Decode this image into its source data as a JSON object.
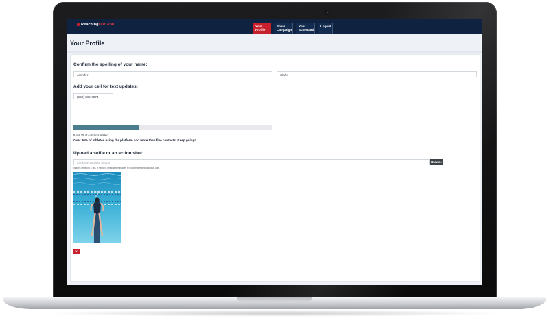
{
  "header": {
    "logo_main": "Reaching",
    "logo_accent": "OurGoal",
    "nav": [
      {
        "label": "Your Profile",
        "active": true
      },
      {
        "label": "Share Campaign",
        "active": false
      },
      {
        "label": "Your Scorecard",
        "active": false
      },
      {
        "label": "Logout",
        "active": false
      }
    ]
  },
  "page": {
    "title": "Your Profile",
    "name_section": {
      "label": "Confirm the spelling of your name:",
      "first_name": "Jennifer",
      "last_name": "Clark"
    },
    "cell_section": {
      "label": "Add your cell for text updates:",
      "phone": "(630) 385-7874"
    },
    "progress": {
      "fraction": 0.33,
      "contacts_text": "5 out 15 of contacts added.",
      "encouragement": "Over 80% of athletes using the platform add more than five contacts. Keep going!"
    },
    "upload_section": {
      "label": "Upload a selfie or an action shot:",
      "file_placeholder": "Click the Browse button",
      "browse_label": "Browse",
      "note": "Images limited to 1 MB. If needed, email larger images to support@reachingourgoal.com.",
      "delete_label": "X"
    }
  },
  "colors": {
    "header_bg": "#0f2340",
    "brand_red": "#c8202c",
    "progress_fill": "#4b7d8f"
  }
}
